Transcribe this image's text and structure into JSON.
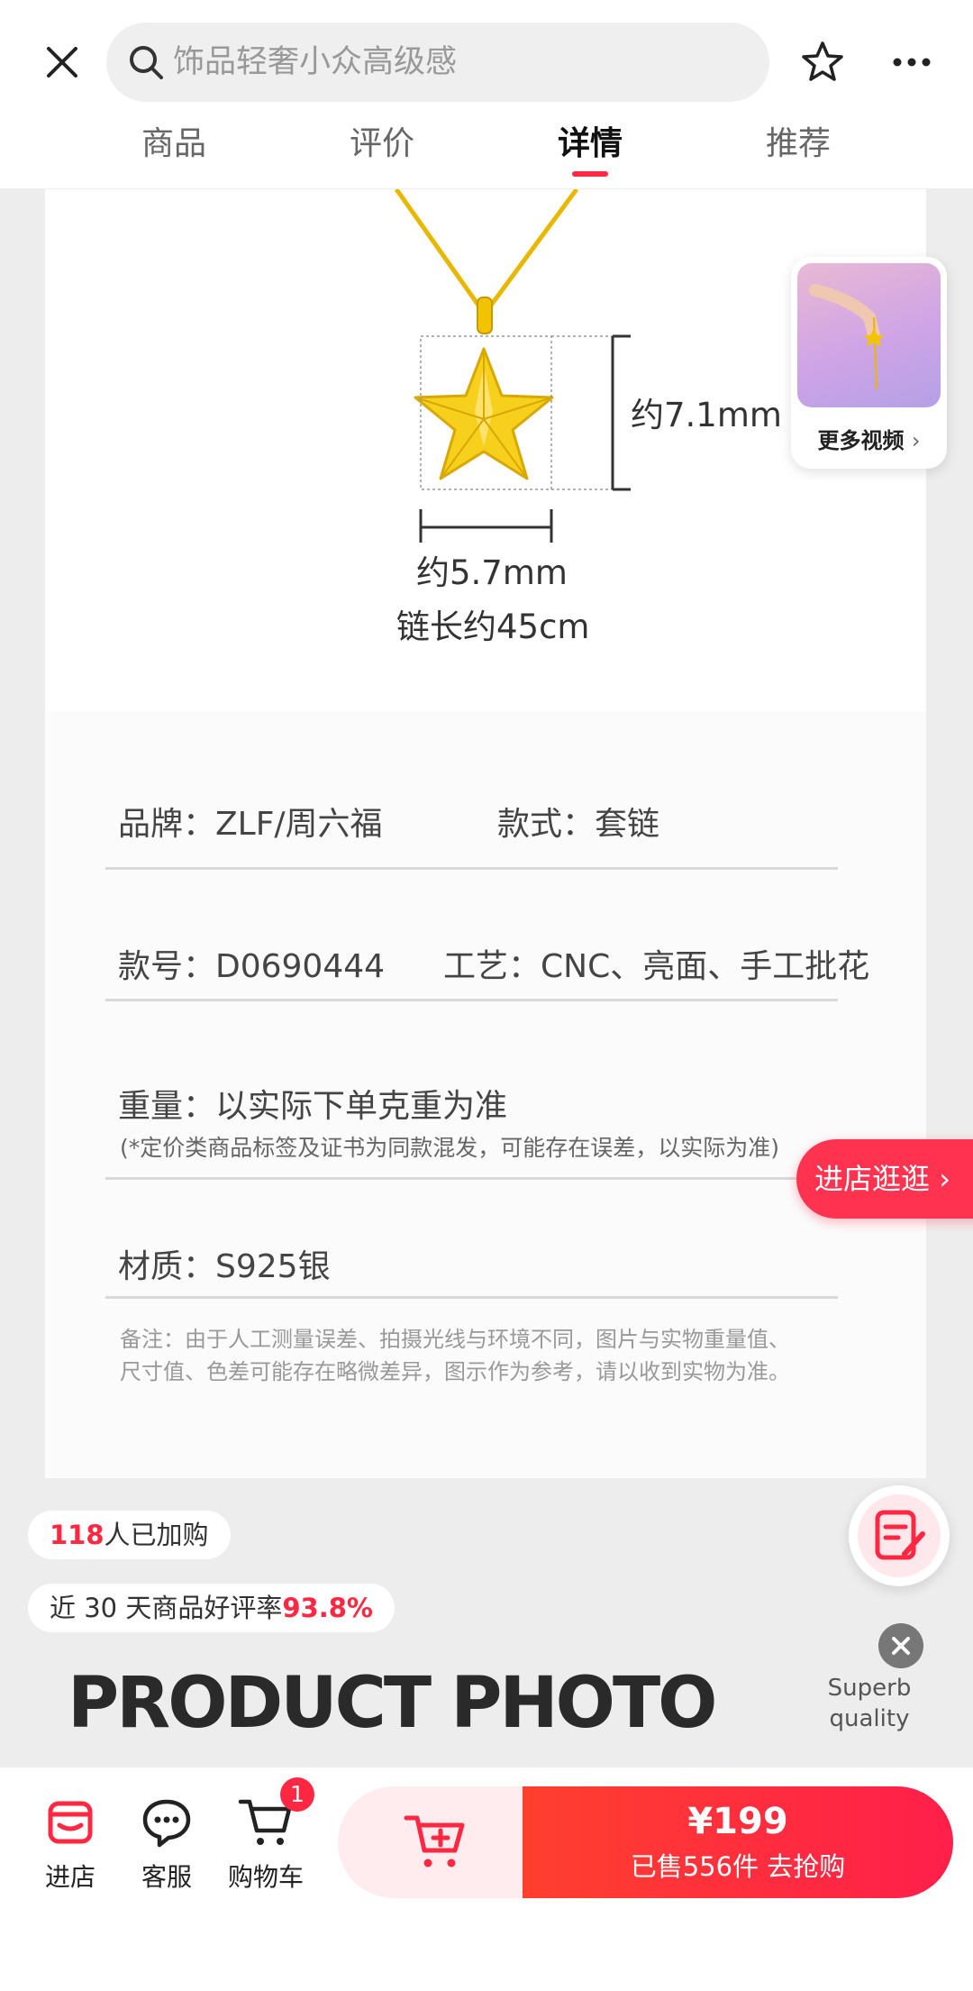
{
  "search": {
    "placeholder": "饰品轻奢小众高级感"
  },
  "tabs": [
    {
      "label": "商品"
    },
    {
      "label": "评价"
    },
    {
      "label": "详情"
    },
    {
      "label": "推荐"
    }
  ],
  "detail": {
    "dim_height": "约7.1mm",
    "dim_width": "约5.7mm",
    "chain_length": "链长约45cm",
    "specs": {
      "brand": "品牌：ZLF/周六福",
      "style": "款式：套链",
      "model": "款号：D0690444",
      "craft": "工艺：CNC、亮面、手工批花",
      "weight": "重量：以实际下单克重为准",
      "weight_note": "(*定价类商品标签及证书为同款混发，可能存在误差，以实际为准)",
      "material": "材质：S925银"
    },
    "remark_line1": "备注：由于人工测量误差、拍摄光线与环境不同，图片与实物重量值、",
    "remark_line2": "尺寸值、色差可能存在略微差异，图示作为参考，请以收到实物为准。"
  },
  "video_card": {
    "label": "更多视频"
  },
  "enter_store": {
    "label": "进店逛逛"
  },
  "badges": {
    "added_count": "118",
    "added_text": "人已加购",
    "rating_prefix": "近 30 天商品好评率",
    "rating_value": "93.8%"
  },
  "superb": {
    "line1": "Superb",
    "line2": "quality"
  },
  "photo_title": "PRODUCT PHOTO",
  "bottom": {
    "store": "进店",
    "service": "客服",
    "cart": "购物车",
    "cart_count": "1",
    "price": "¥199",
    "sold": "已售556件  去抢购"
  },
  "colors": {
    "accent": "#ff2741",
    "gold": "#f2c400"
  }
}
